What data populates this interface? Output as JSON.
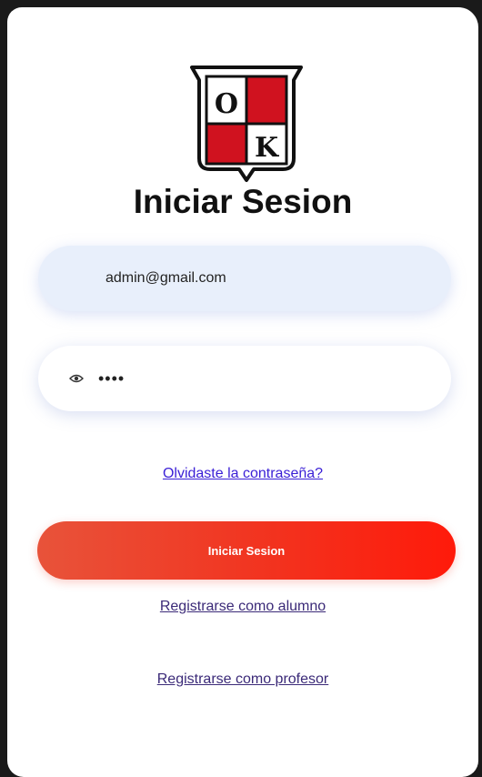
{
  "logo": {
    "letters": [
      "O",
      "K"
    ],
    "colors": {
      "red": "#d0121f",
      "outline": "#111111",
      "white": "#ffffff"
    }
  },
  "page": {
    "title": "Iniciar Sesion"
  },
  "form": {
    "email": {
      "value": "admin@gmail.com",
      "icon": "none"
    },
    "password": {
      "value": "••••",
      "icon": "eye-icon"
    },
    "forgot_password_label": "Olvidaste la contraseña?",
    "submit_label": "Iniciar Sesion",
    "register_student_label": "Registrarse como alumno",
    "register_teacher_label": "Registrarse como profesor"
  },
  "colors": {
    "button_gradient_start": "#e8533a",
    "button_gradient_end": "#ff1a0a",
    "email_field_bg": "#e8effb",
    "link_color": "#3a1fd6"
  }
}
